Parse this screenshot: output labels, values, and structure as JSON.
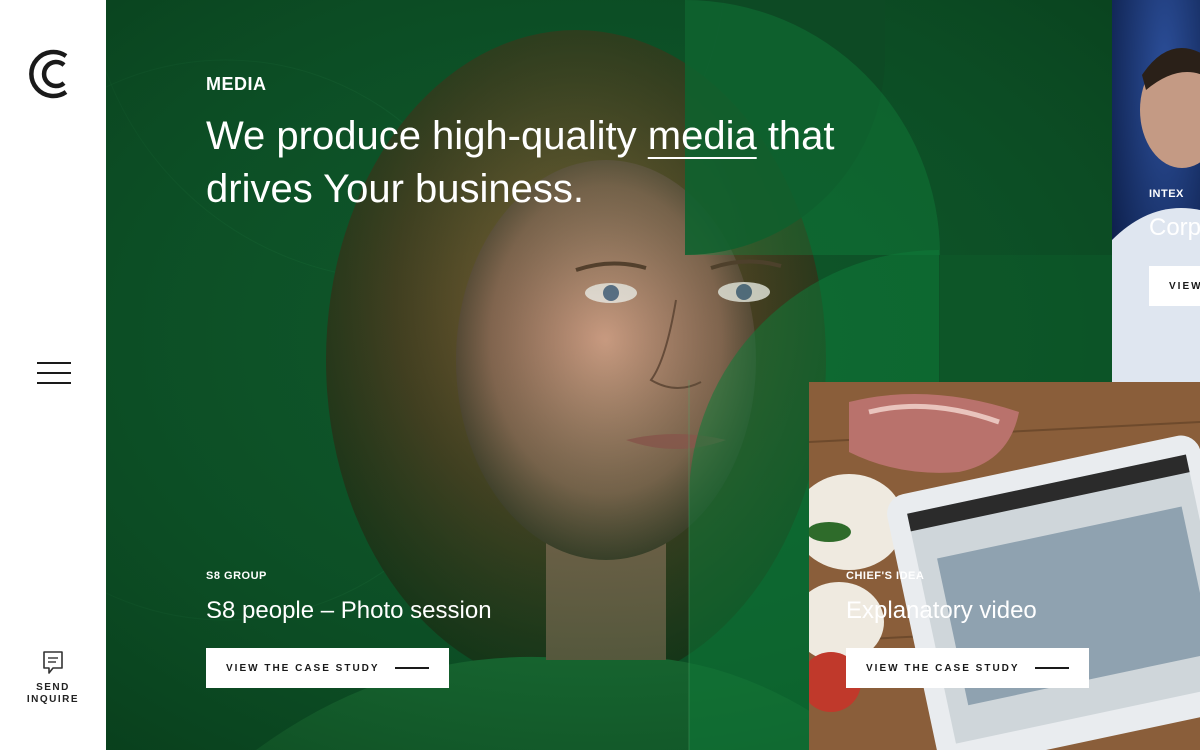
{
  "sidebar": {
    "logo_name": "brand-logo",
    "menu_icon": "hamburger-menu-icon",
    "send_inquire": {
      "line1": "SEND",
      "line2": "INQUIRE",
      "icon": "chat-icon"
    }
  },
  "hero": {
    "section_label": "MEDIA",
    "headline_part1": "We produce high-quality ",
    "headline_link": "media",
    "headline_part2": " that drives Your business.",
    "accent_color": "#0f5a2c"
  },
  "cases": [
    {
      "client": "S8 GROUP",
      "title": "S8 people – Photo session",
      "button": "VIEW THE CASE STUDY"
    },
    {
      "client": "CHIEF'S IDEA",
      "title": "Explanatory video",
      "button": "VIEW THE CASE STUDY"
    },
    {
      "client": "INTEX",
      "title": "Corp",
      "button": "VIEW"
    }
  ]
}
